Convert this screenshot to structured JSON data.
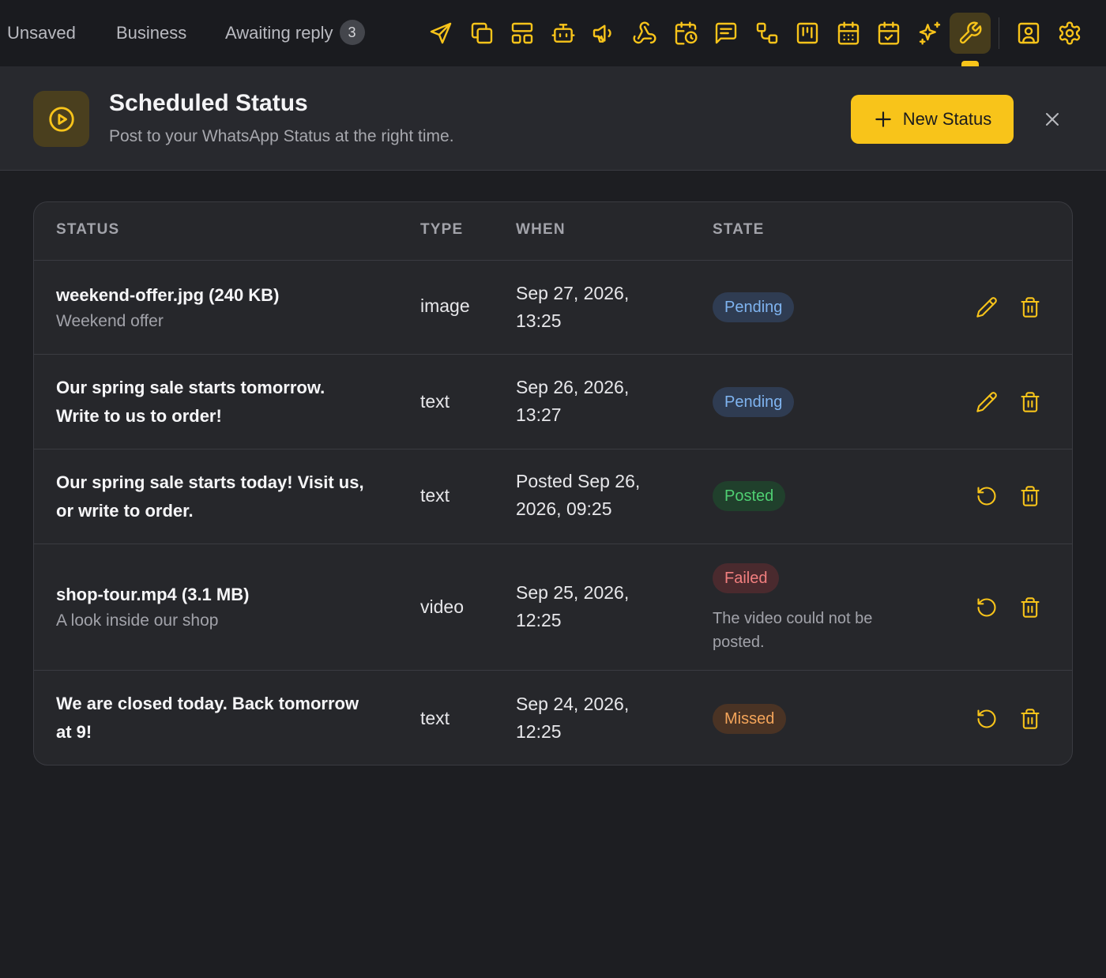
{
  "accent": "#f8c41a",
  "topbar": {
    "tabs": [
      {
        "label": "Unsaved"
      },
      {
        "label": "Business"
      },
      {
        "label": "Awaiting reply",
        "badge": "3"
      }
    ],
    "icons": [
      "send-icon",
      "copy-icon",
      "layout-icon",
      "bot-icon",
      "megaphone-icon",
      "webhook-icon",
      "calendar-clock-icon",
      "message-icon",
      "flow-icon",
      "kanban-icon",
      "calendar-grid-icon",
      "calendar-check-icon",
      "sparkles-icon",
      "wrench-icon",
      "contact-icon",
      "settings-icon"
    ],
    "active_icon": "wrench-icon"
  },
  "header": {
    "icon": "play-circle-icon",
    "title": "Scheduled Status",
    "subtitle": "Post to your WhatsApp Status at the right time.",
    "new_button": "New Status"
  },
  "table": {
    "columns": {
      "status": "STATUS",
      "type": "TYPE",
      "when": "WHEN",
      "state": "STATE"
    },
    "rows": [
      {
        "title": "weekend-offer.jpg (240 KB)",
        "subtitle": "Weekend offer",
        "type": "image",
        "when_1": "Sep 27, 2026,",
        "when_2": "13:25",
        "state": "Pending",
        "state_color": "#7fb4f0",
        "state_bg": "#2f3c52",
        "note": "",
        "actions": [
          "pencil-icon",
          "trash-icon"
        ]
      },
      {
        "title": "Our spring sale starts tomorrow. Write to us to order!",
        "subtitle": "",
        "type": "text",
        "when_1": "Sep 26, 2026,",
        "when_2": "13:27",
        "state": "Pending",
        "state_color": "#7fb4f0",
        "state_bg": "#2f3c52",
        "note": "",
        "actions": [
          "pencil-icon",
          "trash-icon"
        ]
      },
      {
        "title": "Our spring sale starts today! Visit us, or write to order.",
        "subtitle": "",
        "type": "text",
        "when_1": "Posted Sep 26,",
        "when_2": "2026, 09:25",
        "state": "Posted",
        "state_color": "#4fcf72",
        "state_bg": "#20402c",
        "note": "",
        "actions": [
          "retry-icon",
          "trash-icon"
        ]
      },
      {
        "title": "shop-tour.mp4 (3.1 MB)",
        "subtitle": "A look inside our shop",
        "type": "video",
        "when_1": "Sep 25, 2026,",
        "when_2": "12:25",
        "state": "Failed",
        "state_color": "#f27f7f",
        "state_bg": "#4a2a2e",
        "note": "The video could not be posted.",
        "actions": [
          "retry-icon",
          "trash-icon"
        ]
      },
      {
        "title": "We are closed today. Back tomorrow at 9!",
        "subtitle": "",
        "type": "text",
        "when_1": "Sep 24, 2026,",
        "when_2": "12:25",
        "state": "Missed",
        "state_color": "#f5a55a",
        "state_bg": "#4a3324",
        "note": "",
        "actions": [
          "retry-icon",
          "trash-icon"
        ]
      }
    ]
  }
}
